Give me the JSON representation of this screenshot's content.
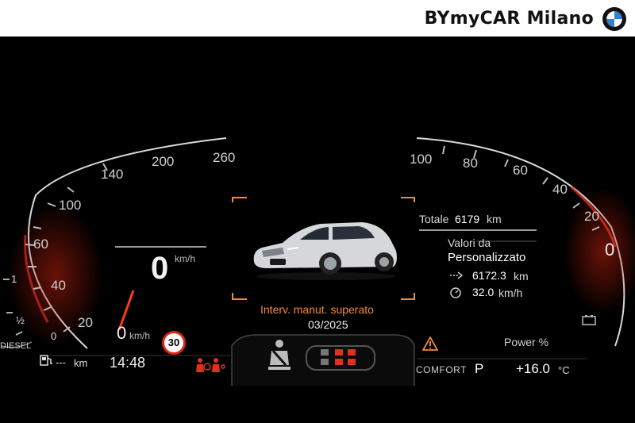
{
  "header": {
    "dealer_name": "BYmyCAR Milano",
    "logo_icon": "bmw-roundel-icon"
  },
  "speedometer": {
    "ticks": [
      "20",
      "40",
      "60",
      "100",
      "140",
      "200",
      "260"
    ],
    "digital_speed": "0",
    "digital_unit": "km/h",
    "needle_speed": "0",
    "needle_unit": "km/h"
  },
  "fuel": {
    "labels": [
      "1",
      "½"
    ],
    "low_label": "0",
    "fuel_type": "DIESEL",
    "range_value": "---",
    "range_unit": "km"
  },
  "clock": "14:48",
  "speed_limit": "30",
  "center": {
    "warning_line1": "Interv. manut. superato",
    "warning_line2": "03/2025"
  },
  "trip": {
    "total_label": "Totale",
    "total_value": "6179",
    "total_unit": "km",
    "values_from_label": "Valori da",
    "mode": "Personalizzato",
    "distance_value": "6172.3",
    "distance_unit": "km",
    "avg_speed_value": "32.0",
    "avg_speed_unit": "km/h"
  },
  "power_gauge": {
    "ticks": [
      "100",
      "80",
      "60",
      "40",
      "20",
      "0"
    ],
    "label": "Power %"
  },
  "status": {
    "drive_mode": "COMFORT",
    "gear": "P",
    "temperature": "+16.0",
    "temperature_unit": "°C"
  },
  "colors": {
    "accent_red": "#e0301e",
    "warning_orange": "#f28a3a",
    "background": "#000000"
  }
}
